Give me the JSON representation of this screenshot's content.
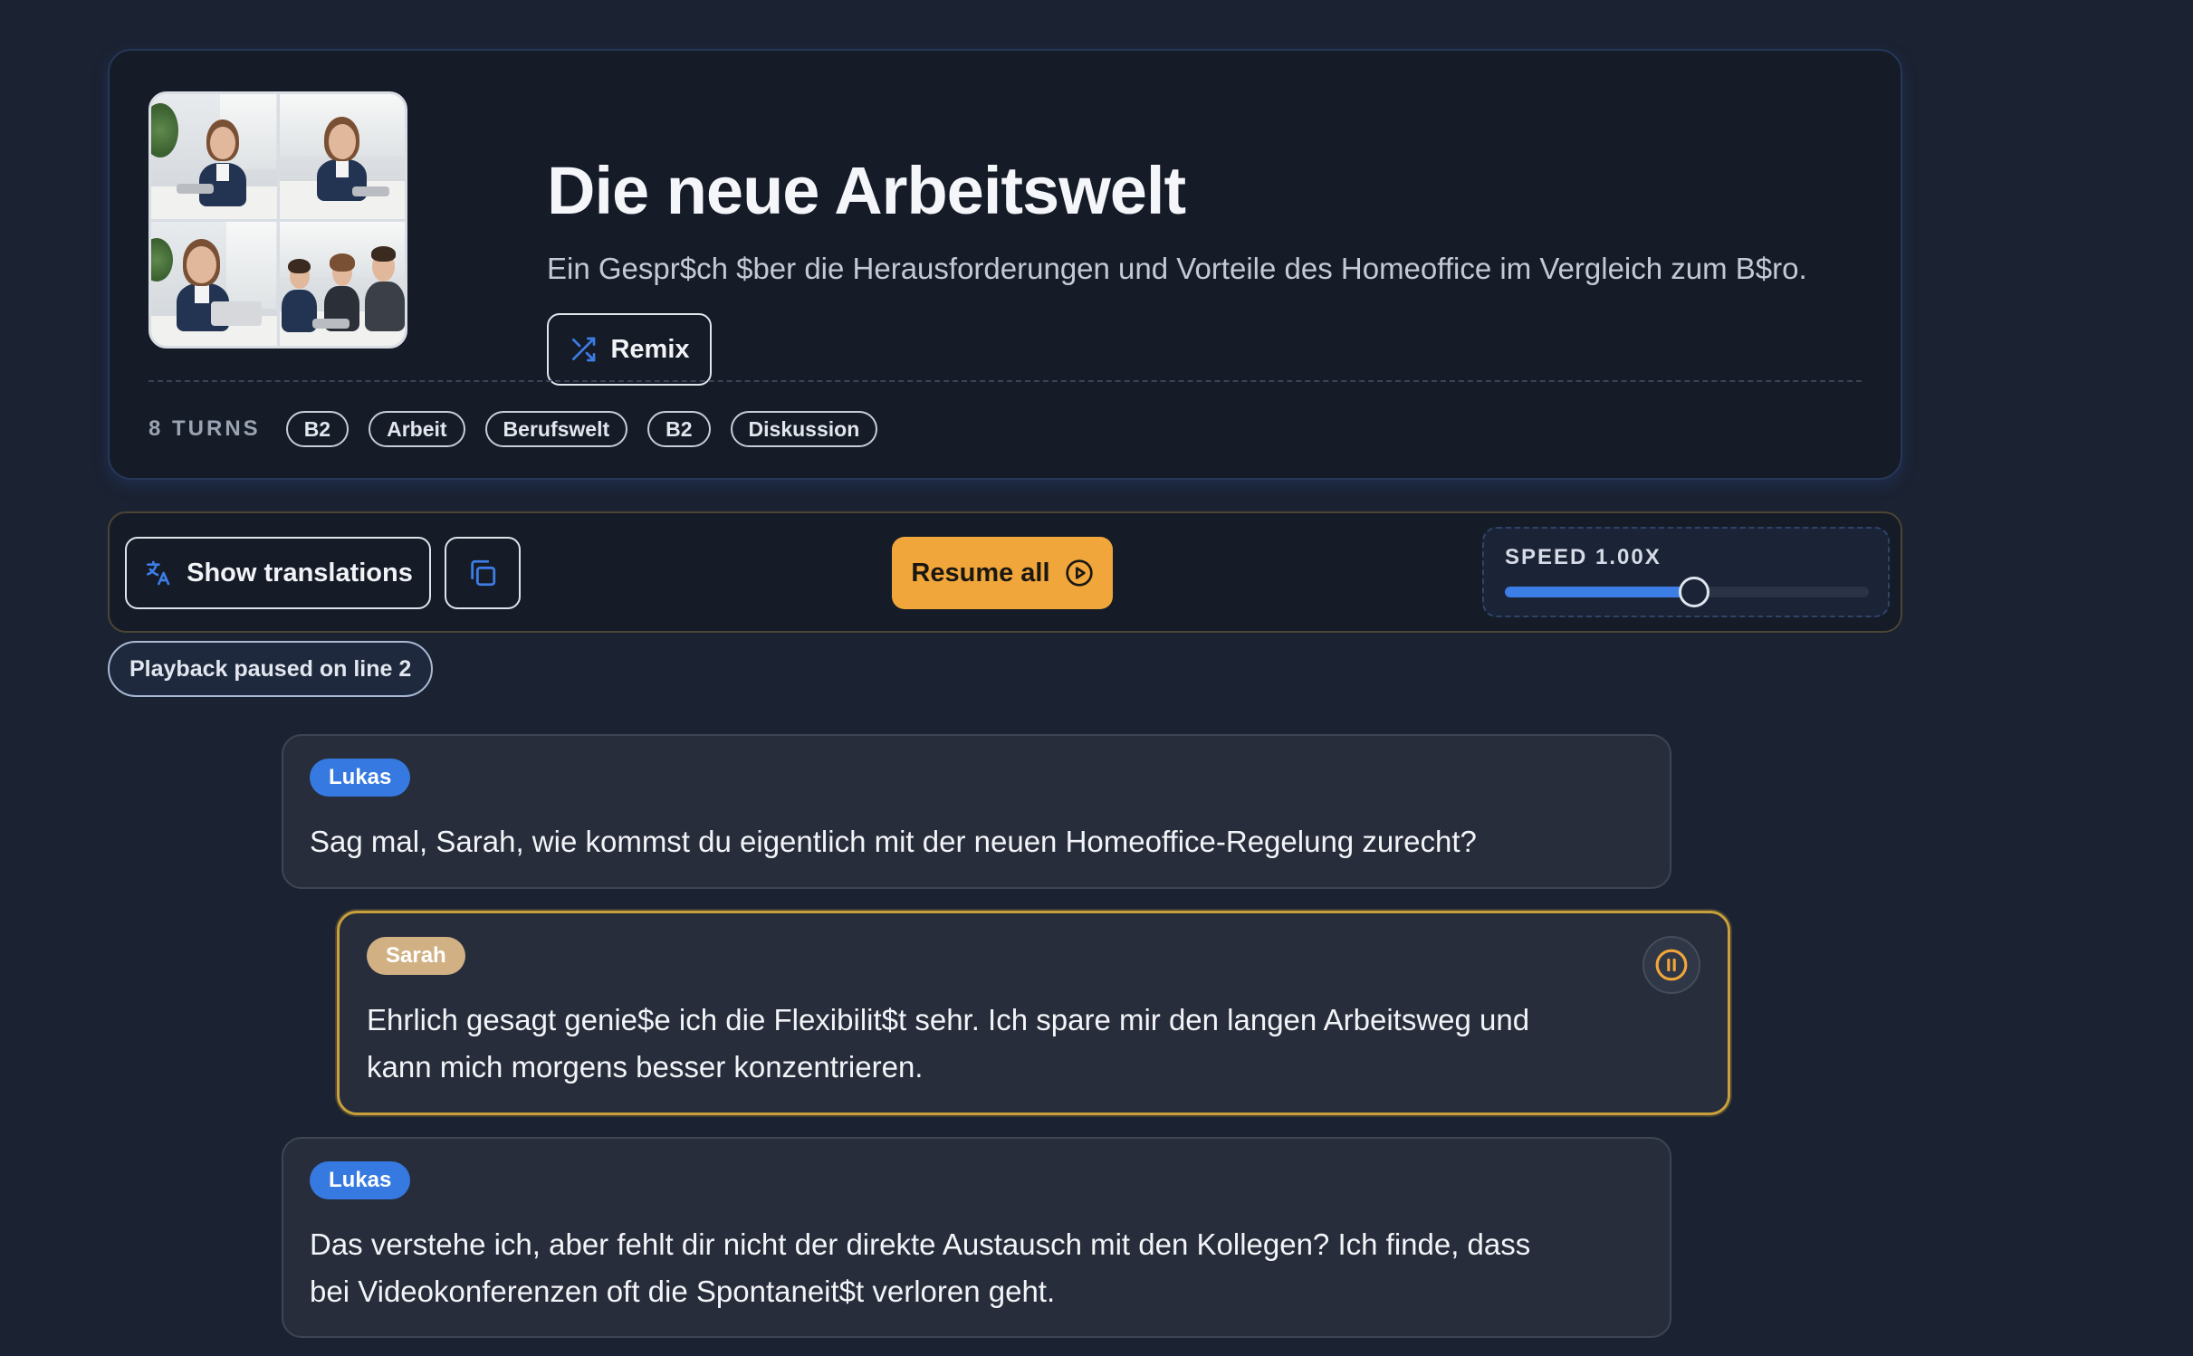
{
  "header": {
    "title": "Die neue Arbeitswelt",
    "subtitle": "Ein Gespr$ch $ber die Herausforderungen und Vorteile des Homeoffice im Vergleich zum B$ro.",
    "remix_label": "Remix",
    "turns_label": "8 TURNS",
    "tags": [
      "B2",
      "Arbeit",
      "Berufswelt",
      "B2",
      "Diskussion"
    ],
    "thumbnail_icon": "office-collage-image"
  },
  "toolbar": {
    "show_translations_label": "Show translations",
    "translate_icon": "translate-icon",
    "copy_icon": "copy-icon",
    "resume_label": "Resume all",
    "resume_icon": "play-circle-icon",
    "speed_label": "SPEED 1.00X",
    "speed_level": 0.52
  },
  "status": {
    "text": "Playback paused on line 2"
  },
  "messages": [
    {
      "speaker": "Lukas",
      "text": "Sag mal, Sarah, wie kommst du eigentlich mit der neuen Homeoffice-Regelung zurecht?"
    },
    {
      "speaker": "Sarah",
      "text": "Ehrlich gesagt genie$e ich die Flexibilit$t sehr. Ich spare mir den langen Arbeitsweg und kann mich morgens besser konzentrieren.",
      "active": true,
      "pause_icon": "pause-circle-icon"
    },
    {
      "speaker": "Lukas",
      "text": "Das verstehe ich, aber fehlt dir nicht der direkte Austausch mit den Kollegen? Ich finde, dass bei Videokonferenzen oft die Spontaneit$t verloren geht."
    }
  ],
  "colors": {
    "background": "#1b2232",
    "accent_orange": "#f0a63a",
    "accent_blue": "#3679e0",
    "speaker_tan": "#d1b184",
    "active_border": "#c9a13a"
  }
}
